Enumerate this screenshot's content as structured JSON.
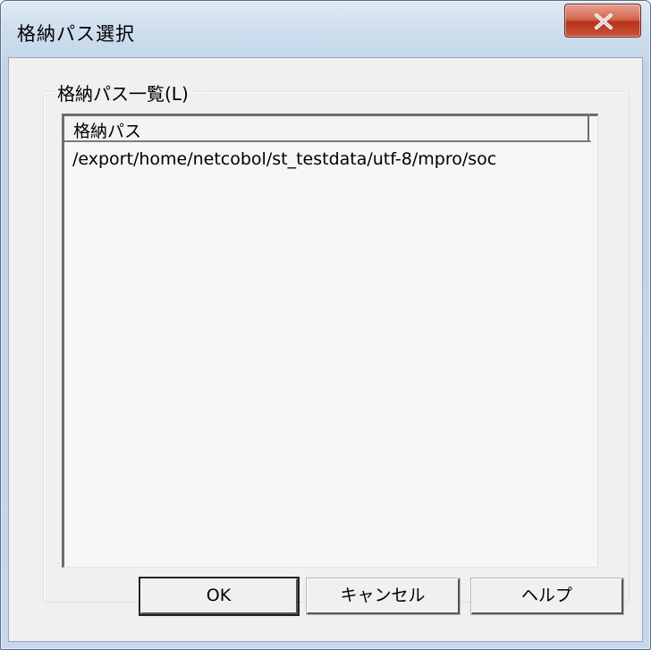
{
  "window": {
    "title": "格納パス選択",
    "close_icon": "close-icon"
  },
  "group": {
    "label": "格納パス一覧(L)"
  },
  "list": {
    "columns": [
      "格納パス"
    ],
    "rows": [
      "/export/home/netcobol/st_testdata/utf-8/mpro/soc"
    ]
  },
  "buttons": {
    "ok": "OK",
    "cancel": "キャンセル",
    "help": "ヘルプ"
  }
}
